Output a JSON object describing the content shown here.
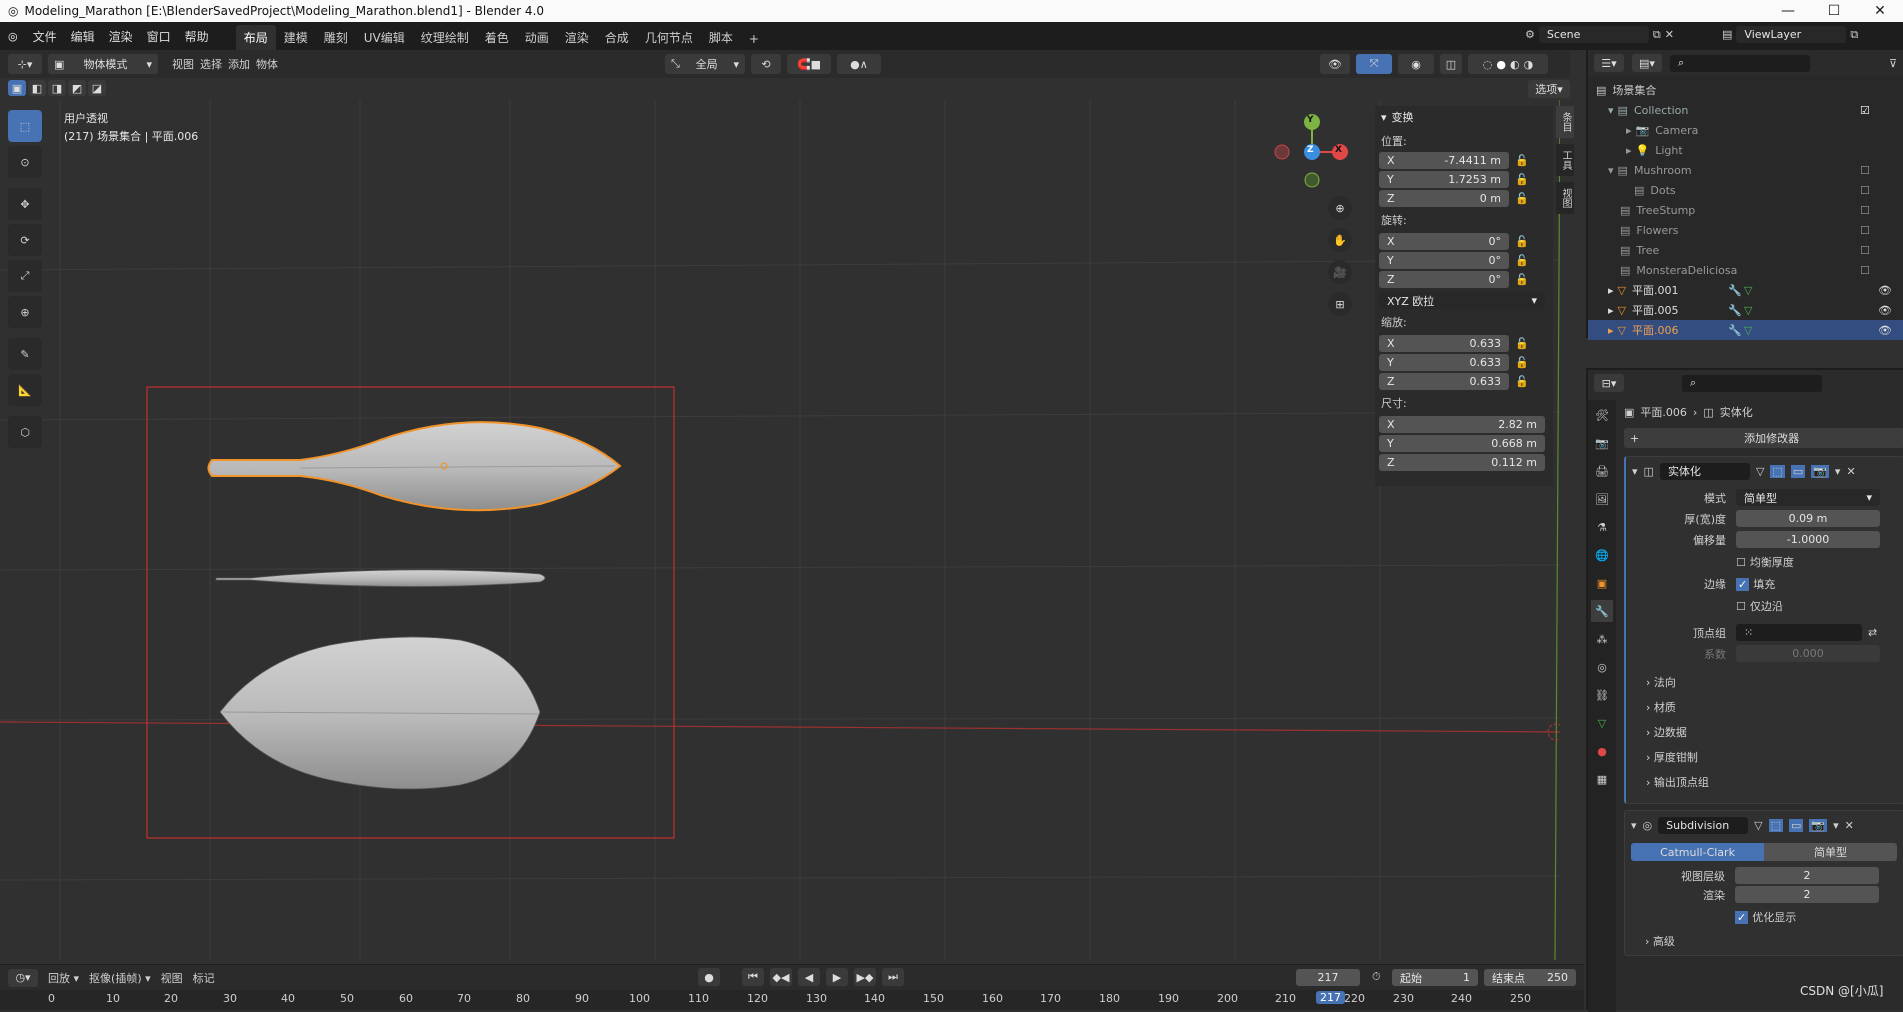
{
  "window": {
    "title": "Modeling_Marathon [E:\\BlenderSavedProject\\Modeling_Marathon.blend1] - Blender 4.0"
  },
  "menu": {
    "items": [
      "文件",
      "编辑",
      "渲染",
      "窗口",
      "帮助"
    ]
  },
  "workspaces": [
    "布局",
    "建模",
    "雕刻",
    "UV编辑",
    "纹理绘制",
    "着色",
    "动画",
    "渲染",
    "合成",
    "几何节点",
    "脚本"
  ],
  "scene": {
    "name": "Scene",
    "view_layer": "ViewLayer"
  },
  "viewport_header": {
    "mode": "物体模式",
    "menus": [
      "视图",
      "选择",
      "添加",
      "物体"
    ],
    "transform": "全局",
    "options": "选项"
  },
  "viewport": {
    "view_name": "用户透视",
    "context": "(217) 场景集合 | 平面.006"
  },
  "npanel": {
    "header": "变换",
    "location_label": "位置:",
    "location": {
      "x": "-7.4411 m",
      "y": "1.7253 m",
      "z": "0 m"
    },
    "rotation_label": "旋转:",
    "rotation": {
      "x": "0°",
      "y": "0°",
      "z": "0°"
    },
    "rotation_mode": "XYZ 欧拉",
    "scale_label": "缩放:",
    "scale": {
      "x": "0.633",
      "y": "0.633",
      "z": "0.633"
    },
    "dimensions_label": "尺寸:",
    "dimensions": {
      "x": "2.82 m",
      "y": "0.668 m",
      "z": "0.112 m"
    },
    "tabs": [
      "条目",
      "工具",
      "视图"
    ]
  },
  "axes": {
    "x": "X",
    "y": "Y",
    "z": "Z"
  },
  "outliner": {
    "root": "场景集合",
    "items": [
      {
        "label": "Collection",
        "level": 1,
        "type": "collection",
        "checked": true
      },
      {
        "label": "Camera",
        "level": 2,
        "type": "camera"
      },
      {
        "label": "Light",
        "level": 2,
        "type": "light"
      },
      {
        "label": "Mushroom",
        "level": 1,
        "type": "collection"
      },
      {
        "label": "Dots",
        "level": 2,
        "type": "collection"
      },
      {
        "label": "TreeStump",
        "level": 1,
        "type": "collection"
      },
      {
        "label": "Flowers",
        "level": 1,
        "type": "collection"
      },
      {
        "label": "Tree",
        "level": 1,
        "type": "collection"
      },
      {
        "label": "MonsteraDeliciosa",
        "level": 1,
        "type": "collection"
      },
      {
        "label": "平面.001",
        "level": 1,
        "type": "mesh"
      },
      {
        "label": "平面.005",
        "level": 1,
        "type": "mesh"
      },
      {
        "label": "平面.006",
        "level": 1,
        "type": "mesh",
        "selected": true
      }
    ]
  },
  "properties": {
    "breadcrumb_object": "平面.006",
    "breadcrumb_modifier": "实体化",
    "add_modifier": "添加修改器",
    "solidify": {
      "name": "实体化",
      "mode_label": "模式",
      "mode": "简单型",
      "thickness_label": "厚(宽)度",
      "thickness": "0.09 m",
      "offset_label": "偏移量",
      "offset": "-1.0000",
      "even_thickness": "均衡厚度",
      "rim_label": "边缘",
      "fill": "填充",
      "only_rim": "仅边沿",
      "vgroup_label": "顶点组",
      "factor_label": "系数",
      "factor": "0.000",
      "sections": [
        "法向",
        "材质",
        "边数据",
        "厚度钳制",
        "输出顶点组"
      ]
    },
    "subdivision": {
      "name": "Subdivision",
      "catmull": "Catmull-Clark",
      "simple": "简单型",
      "viewport_label": "视图层级",
      "viewport": "2",
      "render_label": "渲染",
      "render": "2",
      "optimal": "优化显示",
      "advanced": "高级"
    }
  },
  "timeline": {
    "playback": "回放",
    "keying": "抠像(插帧)",
    "view": "视图",
    "marker": "标记",
    "current_frame": "217",
    "start_label": "起始",
    "start": "1",
    "end_label": "结束点",
    "end": "250",
    "ticks": [
      "0",
      "10",
      "20",
      "30",
      "40",
      "50",
      "60",
      "70",
      "80",
      "90",
      "100",
      "110",
      "120",
      "130",
      "140",
      "150",
      "160",
      "170",
      "180",
      "190",
      "200",
      "210",
      "220",
      "230",
      "240",
      "250"
    ],
    "current_marker": "217"
  },
  "watermark": "CSDN @[小瓜]"
}
